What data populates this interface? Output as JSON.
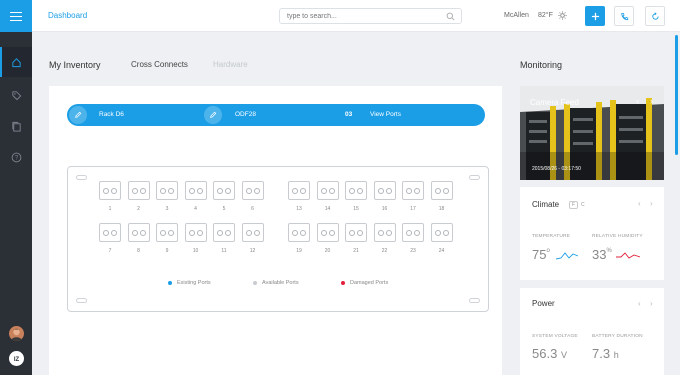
{
  "header": {
    "title": "Dashboard",
    "search_placeholder": "type to search...",
    "location": "McAllen",
    "temperature": "82°F"
  },
  "tabs": [
    {
      "label": "My Inventory",
      "state": "active"
    },
    {
      "label": "Cross Connects",
      "state": "normal"
    },
    {
      "label": "Hardware",
      "state": "disabled"
    }
  ],
  "rack_bar": {
    "rack": "Rack D6",
    "odf": "ODF28",
    "count": "03",
    "link": "View Ports"
  },
  "ports": {
    "row1_top": [
      "1",
      "2",
      "3",
      "4",
      "5",
      "6"
    ],
    "row1_bot": [
      "7",
      "8",
      "9",
      "10",
      "11",
      "12"
    ],
    "row2_top": [
      "13",
      "14",
      "15",
      "16",
      "17",
      "18"
    ],
    "row2_bot": [
      "19",
      "20",
      "21",
      "22",
      "23",
      "24"
    ]
  },
  "legend": [
    {
      "label": "Existing Ports",
      "color": "#1c9ee6"
    },
    {
      "label": "Available Ports",
      "color": "#c8ccd1"
    },
    {
      "label": "Damaged Ports",
      "color": "#e3203b"
    }
  ],
  "monitoring": {
    "title": "Monitoring",
    "camera": {
      "title": "Camera Feed",
      "timestamp": "2015/08/26 - 03:17:50"
    },
    "climate": {
      "title": "Climate",
      "badge": "F",
      "unit_alt": "C",
      "temp_label": "TEMPERATURE",
      "temp_value": "75",
      "temp_unit": "o",
      "humidity_label": "RELATIVE HUMIDITY",
      "humidity_value": "33",
      "humidity_unit": "%"
    },
    "power": {
      "title": "Power",
      "voltage_label": "SYSTEM VOLTAGE",
      "voltage_value": "56.3",
      "voltage_unit": "V",
      "battery_label": "BATTERY DURATION",
      "battery_value": "7.3",
      "battery_unit": "h"
    }
  },
  "colors": {
    "accent": "#1c9ee6",
    "sidebar": "#2b2f36",
    "damaged": "#e3203b"
  }
}
